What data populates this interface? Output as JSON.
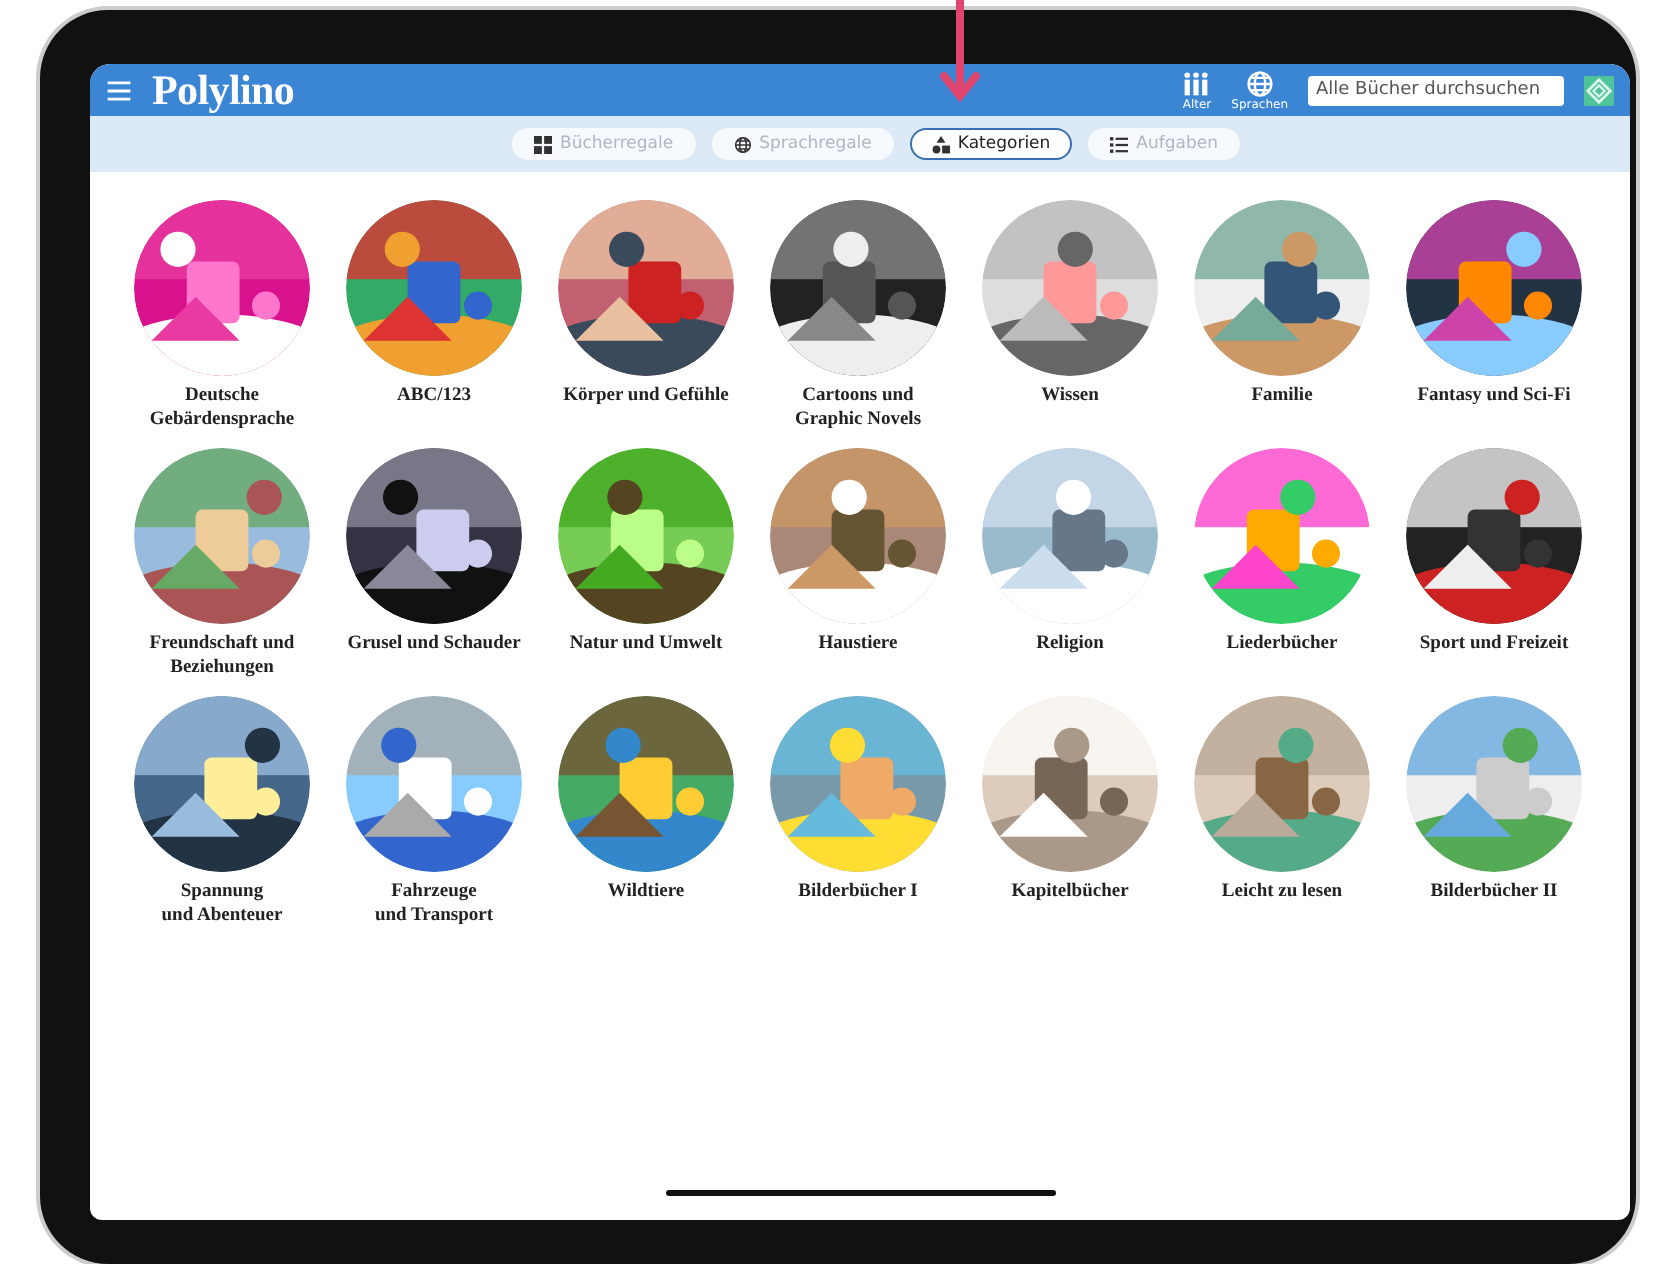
{
  "header": {
    "title": "Polylino",
    "buttons": [
      {
        "label": "Alter",
        "kind": "people"
      },
      {
        "label": "Sprachen",
        "kind": "globe"
      }
    ],
    "search": {
      "placeholder": "Alle Bücher durchsuchen"
    }
  },
  "tabs": [
    {
      "label": "Bücherregale",
      "kind": "grid",
      "selected": false
    },
    {
      "label": "Sprachregale",
      "kind": "globe",
      "selected": false
    },
    {
      "label": "Kategorien",
      "kind": "shapes",
      "selected": true
    },
    {
      "label": "Aufgaben",
      "kind": "list",
      "selected": false
    }
  ],
  "categories": [
    {
      "label": "Deutsche\nGebärdensprache"
    },
    {
      "label": "ABC/123"
    },
    {
      "label": "Körper und Gefühle"
    },
    {
      "label": "Cartoons und\nGraphic Novels"
    },
    {
      "label": "Wissen"
    },
    {
      "label": "Familie"
    },
    {
      "label": "Fantasy und Sci-Fi"
    },
    {
      "label": "Freundschaft und\nBeziehungen"
    },
    {
      "label": "Grusel und Schauder"
    },
    {
      "label": "Natur und Umwelt"
    },
    {
      "label": "Haustiere"
    },
    {
      "label": "Religion"
    },
    {
      "label": "Liederbücher"
    },
    {
      "label": "Sport und Freizeit"
    },
    {
      "label": "Spannung\nund Abenteuer"
    },
    {
      "label": "Fahrzeuge\nund Transport"
    },
    {
      "label": "Wildtiere"
    },
    {
      "label": "Bilderbücher I"
    },
    {
      "label": "Kapitelbücher"
    },
    {
      "label": "Leicht zu lesen"
    },
    {
      "label": "Bilderbücher II"
    }
  ]
}
